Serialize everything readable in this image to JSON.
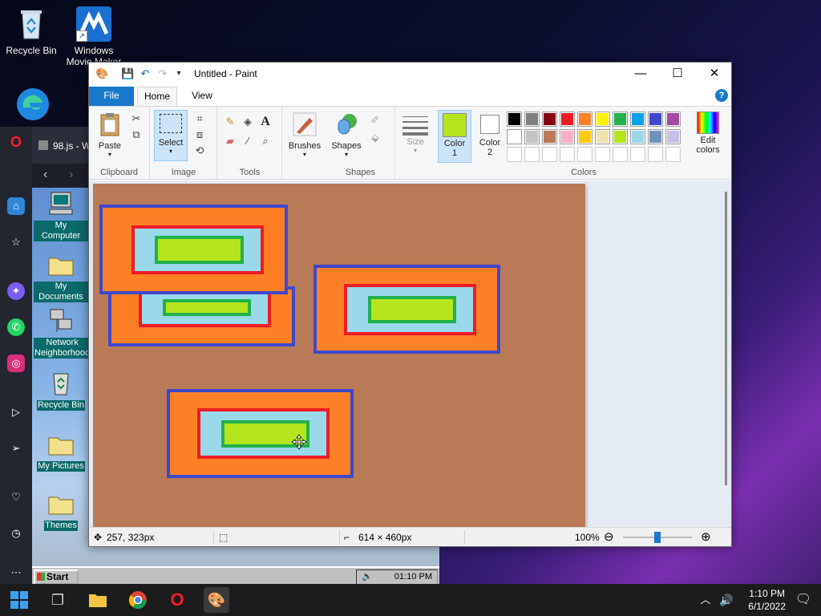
{
  "desktop": {
    "icons": [
      {
        "label": "Recycle Bin"
      },
      {
        "label": "Windows Movie Maker"
      }
    ]
  },
  "opera": {
    "tab_title": "98.js - W",
    "win98": {
      "icons": [
        {
          "label": "My Computer"
        },
        {
          "label": "My Documents"
        },
        {
          "label": "Network Neighborhood"
        },
        {
          "label": "Recycle Bin"
        },
        {
          "label": "My Pictures"
        },
        {
          "label": "Themes"
        }
      ],
      "start_label": "Start",
      "clock": "01:10 PM"
    }
  },
  "paint": {
    "title": "Untitled - Paint",
    "tabs": {
      "file": "File",
      "home": "Home",
      "view": "View"
    },
    "help": "?",
    "groups": {
      "clipboard": "Clipboard",
      "image": "Image",
      "tools": "Tools",
      "shapes": "Shapes",
      "colors": "Colors"
    },
    "buttons": {
      "paste": "Paste",
      "select": "Select",
      "brushes": "Brushes",
      "shapes": "Shapes",
      "size": "Size",
      "color1_line1": "Color",
      "color1_line2": "1",
      "color2_line1": "Color",
      "color2_line2": "2",
      "edit_colors_line1": "Edit",
      "edit_colors_line2": "colors"
    },
    "color1": "#b5e61d",
    "color2": "#ffffff",
    "palette_row1": [
      "#000000",
      "#7f7f7f",
      "#880015",
      "#ed1c24",
      "#ff7f27",
      "#fff200",
      "#22b14c",
      "#00a2e8",
      "#3f48cc",
      "#a349a4"
    ],
    "palette_row2": [
      "#ffffff",
      "#c3c3c3",
      "#b97a57",
      "#ffaec9",
      "#ffc90e",
      "#efe4b0",
      "#b5e61d",
      "#99d9ea",
      "#7092be",
      "#c8bfe7"
    ],
    "canvas_background": "#b97a57",
    "status": {
      "cursor_pos": "257, 323px",
      "canvas_size": "614 × 460px",
      "zoom": "100%"
    },
    "zoom_level": 100
  },
  "taskbar": {
    "time": "1:10 PM",
    "date": "6/1/2022"
  }
}
